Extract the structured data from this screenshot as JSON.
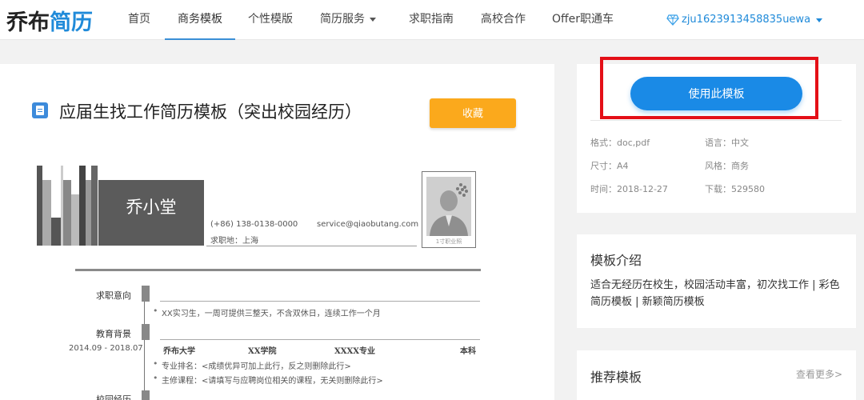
{
  "logo": {
    "part1": "乔布",
    "part2": "简历"
  },
  "nav": {
    "items": [
      {
        "label": "首页"
      },
      {
        "label": "商务模板"
      },
      {
        "label": "个性模版"
      },
      {
        "label": "简历服务"
      },
      {
        "label": "求职指南"
      },
      {
        "label": "高校合作"
      },
      {
        "label": "Offer职通车"
      }
    ],
    "active_index": 1,
    "username": "zju1623913458835uewa"
  },
  "template": {
    "title": "应届生找工作简历模板（突出校园经历）",
    "favorite_label": "收藏"
  },
  "resume": {
    "name": "乔小堂",
    "phone": "(+86) 138-0138-0000",
    "email": "service@qiaobutang.com",
    "location": "求职地：上海",
    "photo_caption": "1寸职业照",
    "sections": [
      {
        "title": "求职意向"
      },
      {
        "title": "教育背景"
      },
      {
        "title": "校园经历"
      }
    ],
    "objective": "XX实习生，一周可提供三整天，不含双休日，连续工作一个月",
    "education": {
      "dates": "2014.09 - 2018.07",
      "school": "乔布大学",
      "college": "XX学院",
      "major": "XXXX专业",
      "degree": "本科",
      "bullets": [
        "专业排名：<成绩优异可加上此行，反之则删除此行>",
        "主修课程：<请填写与应聘岗位相关的课程，无关则删除此行>"
      ]
    }
  },
  "sidebar": {
    "use_button": "使用此模板",
    "meta": {
      "format": "格式：doc,pdf",
      "language": "语言：中文",
      "size": "尺寸：A4",
      "style": "风格：商务",
      "time": "时间：2018-12-27",
      "downloads": "下载：529580"
    },
    "intro_title": "模板介绍",
    "intro_text": "适合无经历在校生，校园活动丰富，初次找工作 | 彩色简历模板 | 新颖简历模板",
    "recommend_title": "推荐模板",
    "more_label": "查看更多>"
  },
  "colors": {
    "accent_blue": "#1a8ae6",
    "favorite_orange": "#fba91c",
    "highlight_red": "#e40f17"
  }
}
